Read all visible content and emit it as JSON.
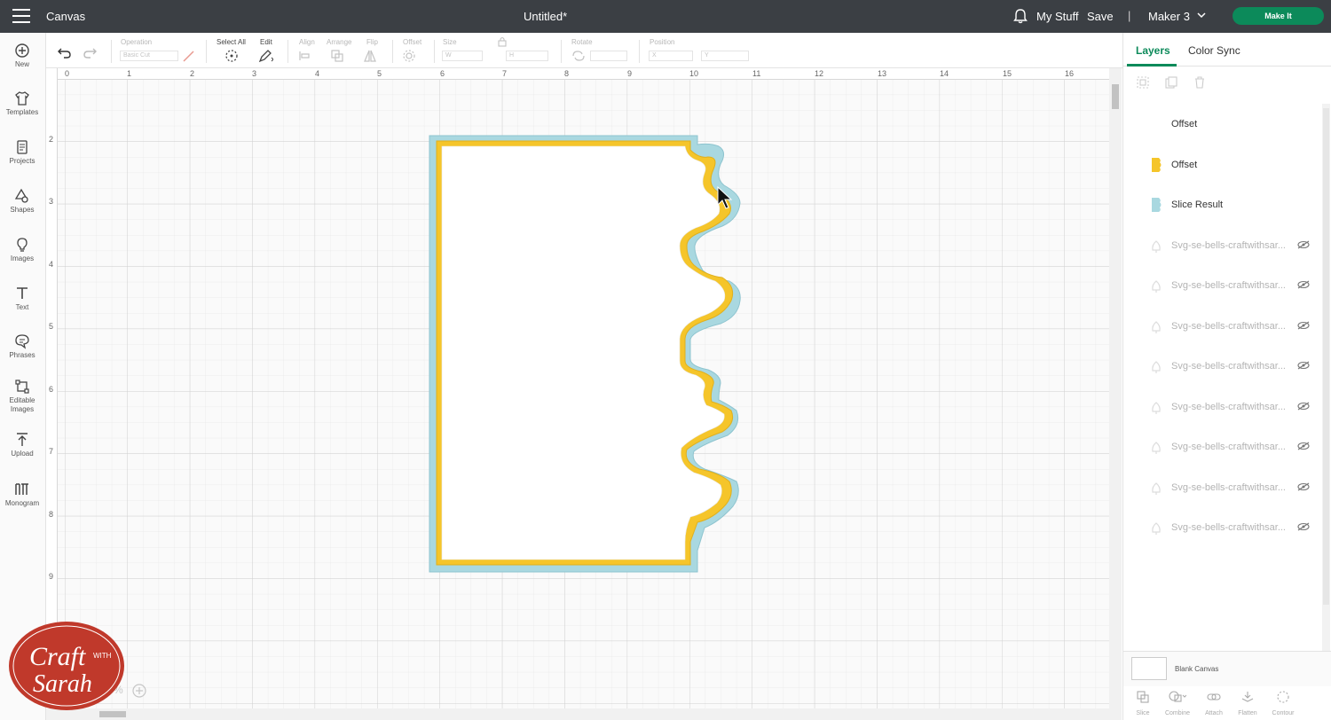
{
  "topbar": {
    "menu_icon": "hamburger-icon",
    "app_title": "Canvas",
    "doc_title": "Untitled*",
    "notification_icon": "bell-icon",
    "my_stuff": "My Stuff",
    "save": "Save",
    "separator": "|",
    "machine": "Maker 3",
    "make_it": "Make It",
    "make_it_color": "#0c8a5a"
  },
  "toolbar": {
    "operation_label": "Operation",
    "operation_value": "Basic Cut",
    "select_all_label": "Select All",
    "edit_label": "Edit",
    "align_label": "Align",
    "arrange_label": "Arrange",
    "flip_label": "Flip",
    "offset_label": "Offset",
    "size_label": "Size",
    "size_w": "W",
    "size_h": "H",
    "rotate_label": "Rotate",
    "position_label": "Position",
    "position_x": "X",
    "position_y": "Y"
  },
  "leftbar": {
    "items": [
      {
        "label": "New",
        "icon": "plus-circle-icon"
      },
      {
        "label": "Templates",
        "icon": "shirt-icon"
      },
      {
        "label": "Projects",
        "icon": "projects-icon"
      },
      {
        "label": "Shapes",
        "icon": "shapes-icon"
      },
      {
        "label": "Images",
        "icon": "lightbulb-icon"
      },
      {
        "label": "Text",
        "icon": "text-icon"
      },
      {
        "label": "Phrases",
        "icon": "speech-bubble-icon"
      },
      {
        "label": "Editable Images",
        "icon": "editable-images-icon"
      },
      {
        "label": "Upload",
        "icon": "upload-icon"
      },
      {
        "label": "Monogram",
        "icon": "monogram-icon"
      }
    ]
  },
  "ruler": {
    "top": [
      "0",
      "1",
      "2",
      "3",
      "4",
      "5",
      "6",
      "7",
      "8",
      "9",
      "10",
      "11",
      "12",
      "13",
      "14",
      "15",
      "16"
    ],
    "left": [
      "2",
      "3",
      "4",
      "5",
      "6",
      "7",
      "8",
      "9"
    ]
  },
  "design": {
    "outer_color": "#a9d8e0",
    "middle_color": "#f5c52a",
    "inner_color": "#ffffff"
  },
  "zoom": {
    "value": "%"
  },
  "rightpanel": {
    "tabs": [
      "Layers",
      "Color Sync"
    ],
    "layers": [
      {
        "name": "Offset",
        "swatch": "#ffffff",
        "hidden": false
      },
      {
        "name": "Offset",
        "swatch": "#f5c52a",
        "hidden": false
      },
      {
        "name": "Slice Result",
        "swatch": "#a9d8e0",
        "hidden": false
      },
      {
        "name": "Svg-se-bells-craftwithsar...",
        "swatch": "",
        "hidden": true
      },
      {
        "name": "Svg-se-bells-craftwithsar...",
        "swatch": "",
        "hidden": true
      },
      {
        "name": "Svg-se-bells-craftwithsar...",
        "swatch": "",
        "hidden": true
      },
      {
        "name": "Svg-se-bells-craftwithsar...",
        "swatch": "",
        "hidden": true
      },
      {
        "name": "Svg-se-bells-craftwithsar...",
        "swatch": "",
        "hidden": true
      },
      {
        "name": "Svg-se-bells-craftwithsar...",
        "swatch": "",
        "hidden": true
      },
      {
        "name": "Svg-se-bells-craftwithsar...",
        "swatch": "",
        "hidden": true
      },
      {
        "name": "Svg-se-bells-craftwithsar...",
        "swatch": "",
        "hidden": true
      }
    ],
    "blank_canvas": "Blank Canvas",
    "bottom_actions": [
      "Slice",
      "Combine",
      "Attach",
      "Flatten",
      "Contour"
    ]
  },
  "watermark": {
    "line1": "Craft",
    "line2": "WITH",
    "line3": "Sarah",
    "color": "#c0392b"
  }
}
